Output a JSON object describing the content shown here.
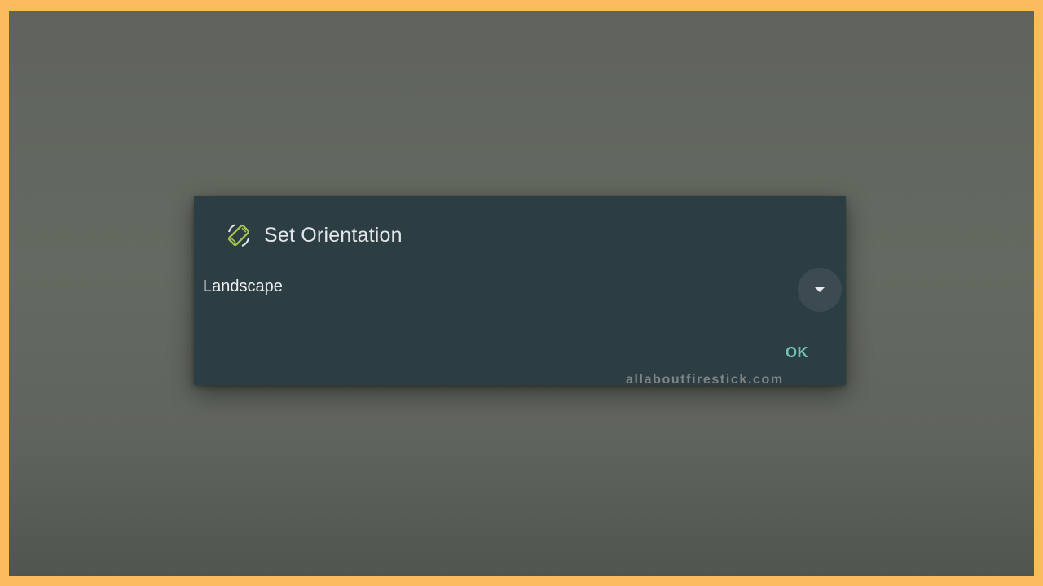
{
  "dialog": {
    "title": "Set Orientation",
    "title_icon": "screen-rotation-icon",
    "select": {
      "value": "Landscape",
      "icon": "chevron-down-icon"
    },
    "ok_label": "OK"
  },
  "watermark": "allaboutfirestick.com",
  "colors": {
    "border": "#fcbb5c",
    "dialog_background": "#2d3d44",
    "accent": "#6fc3b4",
    "icon_accent": "#a6c34a"
  }
}
